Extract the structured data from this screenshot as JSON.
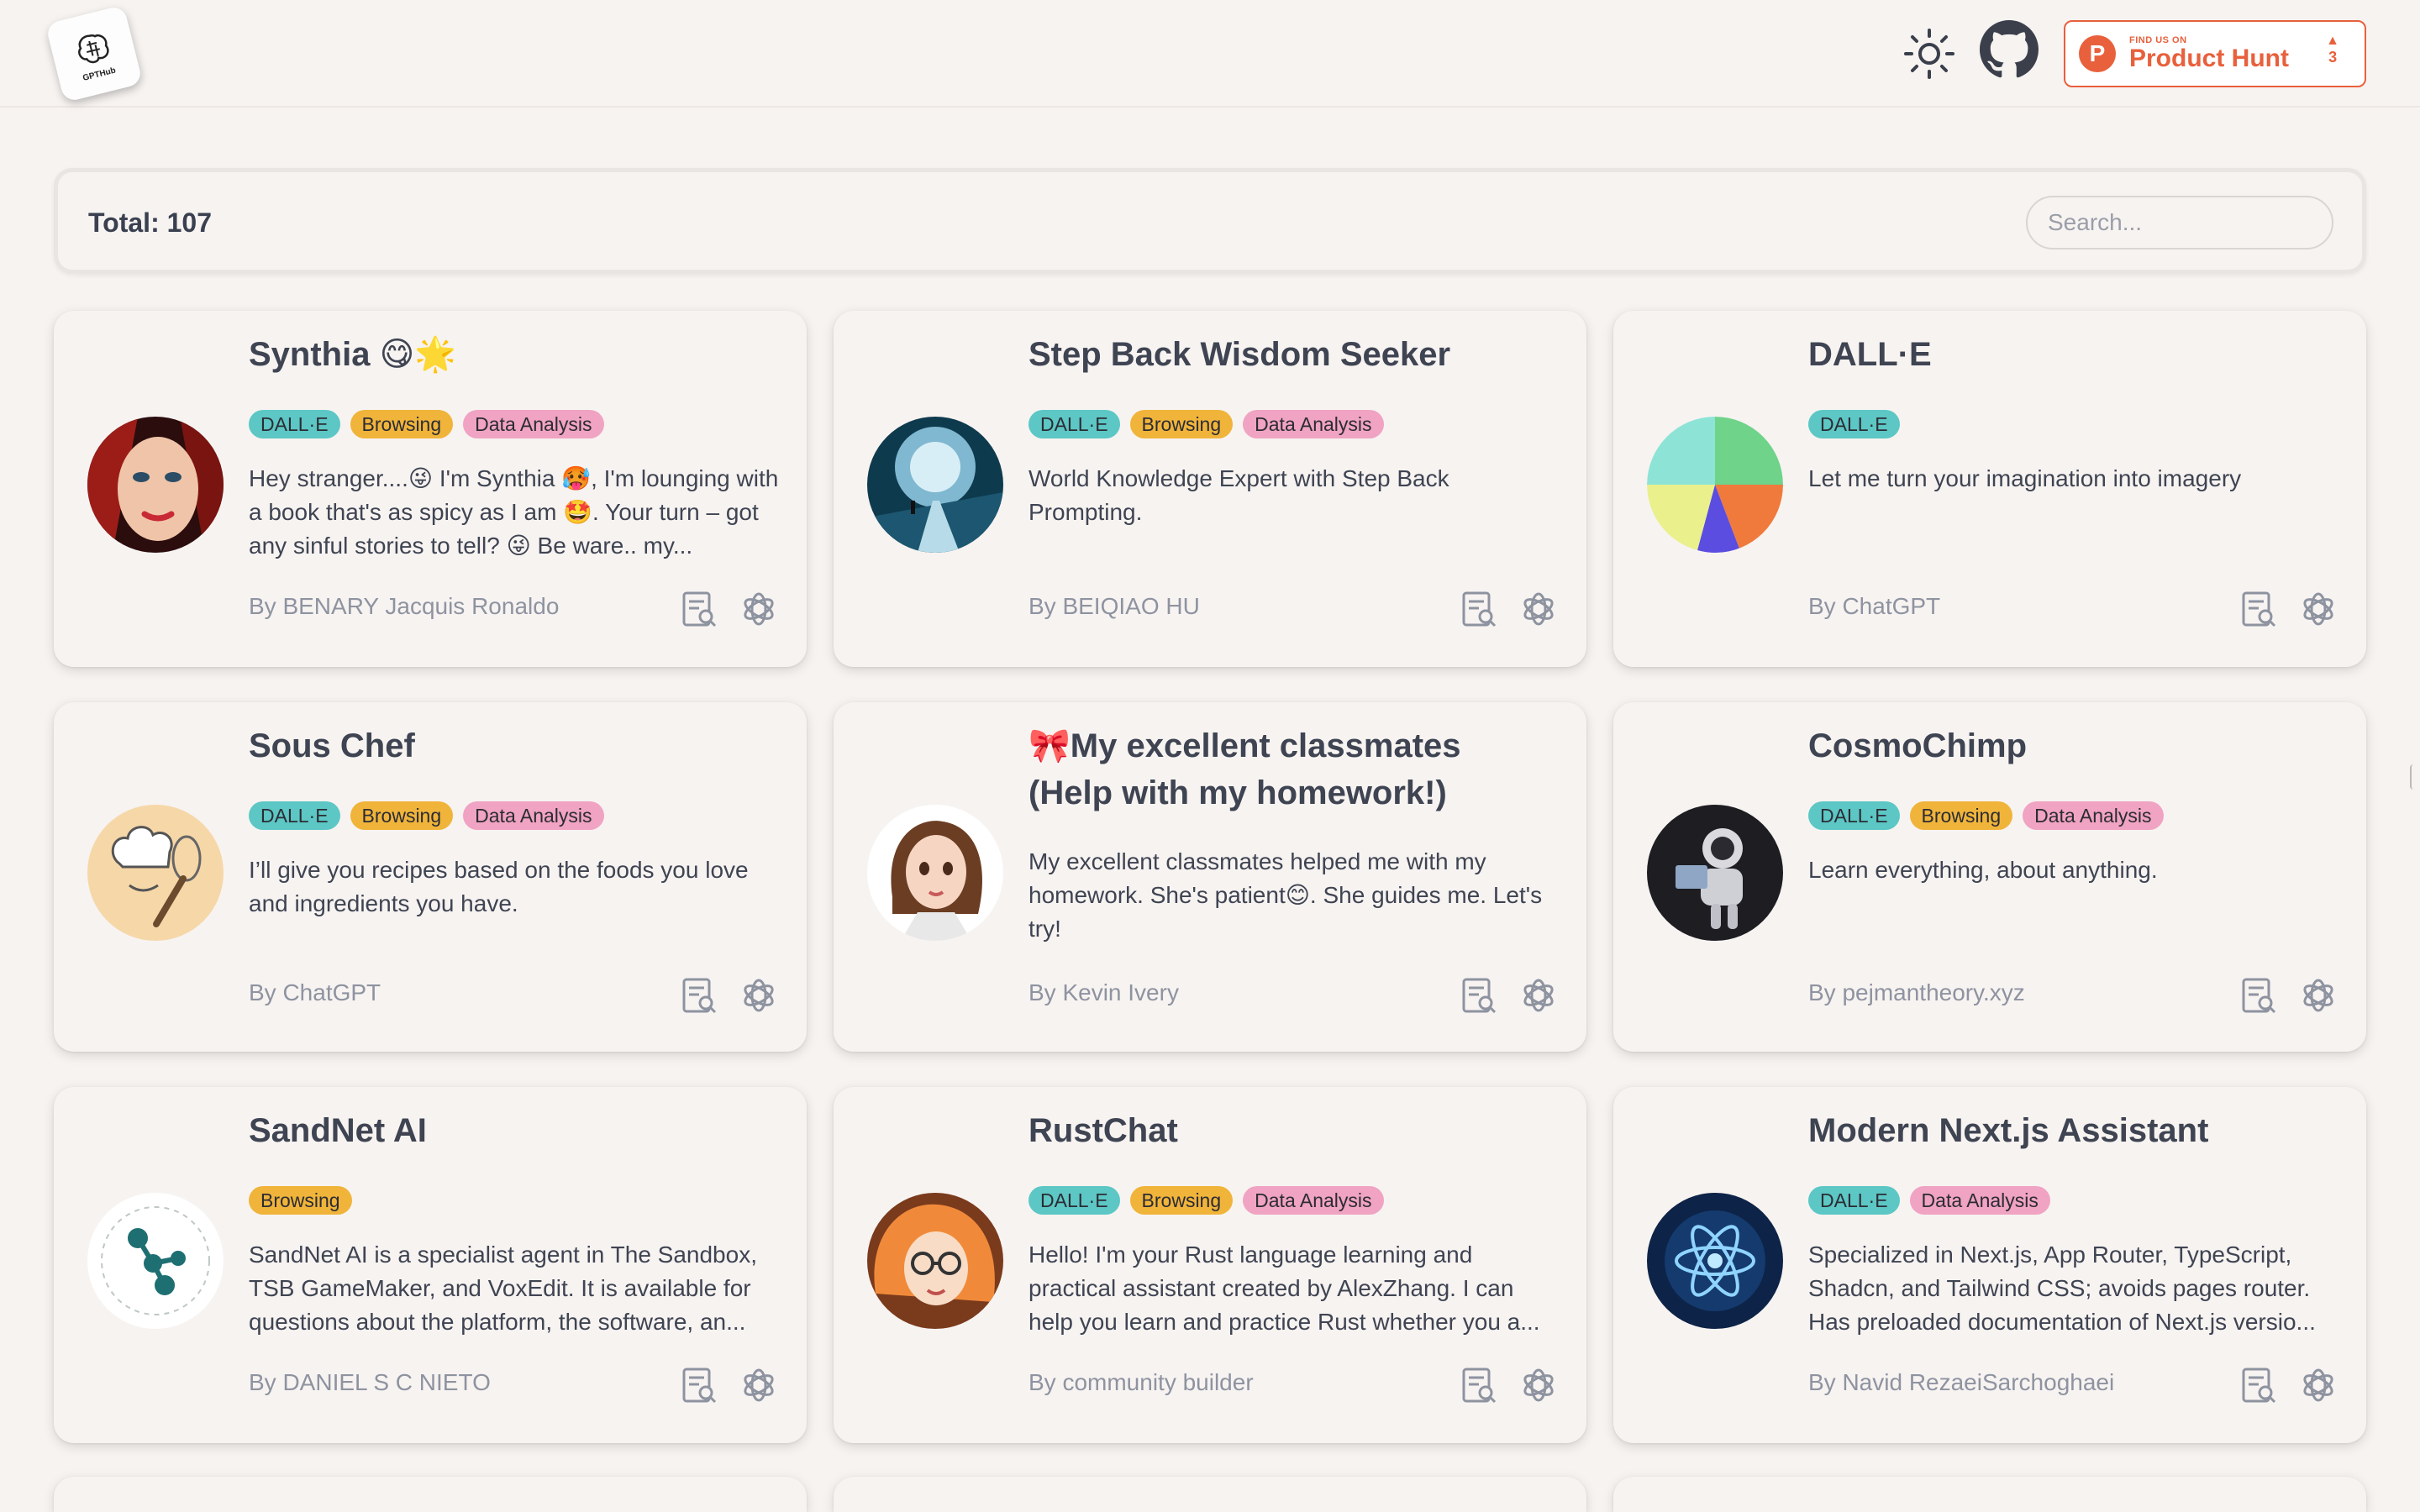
{
  "header": {
    "logo_text": "GPTHub",
    "product_hunt": {
      "small": "FIND US ON",
      "big": "Product Hunt",
      "votes": "3",
      "letter": "P"
    }
  },
  "total_label": "Total: 107",
  "search": {
    "placeholder": "Search..."
  },
  "cards": [
    {
      "title": "Synthia 😋🌟",
      "tags": [
        "DALL·E",
        "Browsing",
        "Data Analysis"
      ],
      "description": "Hey stranger....😜 I'm Synthia 🥵, I'm lounging with a book that's as spicy as I am 🤩. Your turn – got any sinful stories to tell? 😜 Be ware.. my...",
      "author": "By BENARY Jacquis Ronaldo"
    },
    {
      "title": "Step Back Wisdom Seeker",
      "tags": [
        "DALL·E",
        "Browsing",
        "Data Analysis"
      ],
      "description": "World Knowledge Expert with Step Back Prompting.",
      "author": "By BEIQIAO HU"
    },
    {
      "title": "DALL·E",
      "tags": [
        "DALL·E"
      ],
      "description": "Let me turn your imagination into imagery",
      "author": "By ChatGPT"
    },
    {
      "title": "Sous Chef",
      "tags": [
        "DALL·E",
        "Browsing",
        "Data Analysis"
      ],
      "description": "I’ll give you recipes based on the foods you love and ingredients you have.",
      "author": "By ChatGPT"
    },
    {
      "title": "🎀My excellent classmates (Help with my homework!)",
      "tags": [],
      "description": "My excellent classmates helped me with my homework. She's patient😊. She guides me. Let's try!",
      "author": "By Kevin Ivery"
    },
    {
      "title": "CosmoChimp",
      "tags": [
        "DALL·E",
        "Browsing",
        "Data Analysis"
      ],
      "description": "Learn everything, about anything.",
      "author": "By pejmantheory.xyz"
    },
    {
      "title": "SandNet AI",
      "tags": [
        "Browsing"
      ],
      "description": "SandNet AI is a specialist agent in The Sandbox, TSB GameMaker, and VoxEdit. It is available for questions about the platform, the software, an...",
      "author": "By DANIEL S C NIETO"
    },
    {
      "title": "RustChat",
      "tags": [
        "DALL·E",
        "Browsing",
        "Data Analysis"
      ],
      "description": "Hello! I'm your Rust language learning and practical assistant created by AlexZhang. I can help you learn and practice Rust whether you a...",
      "author": "By community builder"
    },
    {
      "title": "Modern Next.js Assistant",
      "tags": [
        "DALL·E",
        "Data Analysis"
      ],
      "description": "Specialized in Next.js, App Router, TypeScript, Shadcn, and Tailwind CSS; avoids pages router. Has preloaded documentation of Next.js versio...",
      "author": "By Navid RezaeiSarchoghaei"
    }
  ]
}
